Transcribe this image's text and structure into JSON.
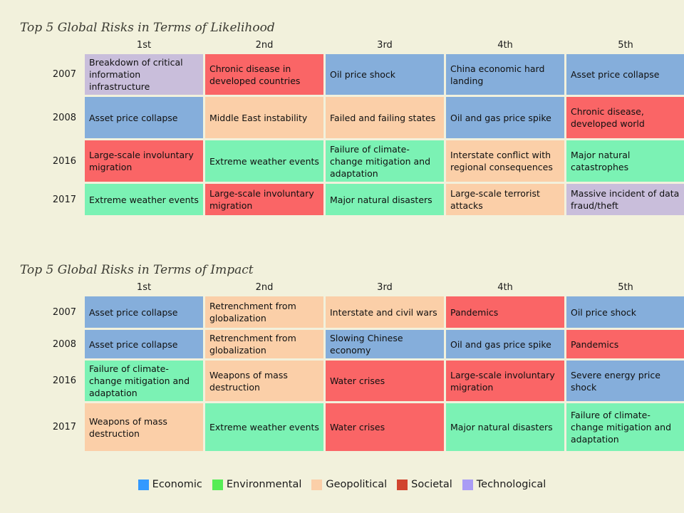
{
  "background_color": "#F2F1DC",
  "category_colors": {
    "economic": "#85AEDB",
    "environmental": "#7BF2B4",
    "geopolitical": "#FBCFA8",
    "societal": "#FA6566",
    "technological": "#C9BEDB"
  },
  "likelihood": {
    "title": "Top 5 Global Risks in Terms of Likelihood",
    "columns": [
      "1st",
      "2nd",
      "3rd",
      "4th",
      "5th"
    ],
    "rows": [
      {
        "year": "2007",
        "cells": [
          {
            "text": "Breakdown of critical information infrastructure",
            "category": "technological"
          },
          {
            "text": "Chronic disease in developed countries",
            "category": "societal"
          },
          {
            "text": "Oil price shock",
            "category": "economic"
          },
          {
            "text": "China economic hard landing",
            "category": "economic"
          },
          {
            "text": "Asset price collapse",
            "category": "economic"
          }
        ]
      },
      {
        "year": "2008",
        "cells": [
          {
            "text": "Asset price collapse",
            "category": "economic"
          },
          {
            "text": "Middle East instability",
            "category": "geopolitical"
          },
          {
            "text": "Failed and failing states",
            "category": "geopolitical"
          },
          {
            "text": "Oil and gas price spike",
            "category": "economic"
          },
          {
            "text": "Chronic disease, developed world",
            "category": "societal"
          }
        ]
      },
      {
        "year": "2016",
        "cells": [
          {
            "text": "Large-scale involuntary migration",
            "category": "societal"
          },
          {
            "text": "Extreme weather events",
            "category": "environmental"
          },
          {
            "text": "Failure of climate-change mitigation and adaptation",
            "category": "environmental"
          },
          {
            "text": "Interstate conflict with regional consequences",
            "category": "geopolitical"
          },
          {
            "text": "Major natural catastrophes",
            "category": "environmental"
          }
        ]
      },
      {
        "year": "2017",
        "cells": [
          {
            "text": "Extreme weather events",
            "category": "environmental"
          },
          {
            "text": "Large-scale involuntary migration",
            "category": "societal"
          },
          {
            "text": "Major natural disasters",
            "category": "environmental"
          },
          {
            "text": "Large-scale terrorist attacks",
            "category": "geopolitical"
          },
          {
            "text": "Massive incident of data fraud/theft",
            "category": "technological"
          }
        ]
      }
    ]
  },
  "impact": {
    "title": "Top 5 Global Risks in Terms of Impact",
    "columns": [
      "1st",
      "2nd",
      "3rd",
      "4th",
      "5th"
    ],
    "rows": [
      {
        "year": "2007",
        "cells": [
          {
            "text": "Asset price collapse",
            "category": "economic"
          },
          {
            "text": "Retrenchment from globalization",
            "category": "geopolitical"
          },
          {
            "text": "Interstate and civil wars",
            "category": "geopolitical"
          },
          {
            "text": "Pandemics",
            "category": "societal"
          },
          {
            "text": "Oil price shock",
            "category": "economic"
          }
        ]
      },
      {
        "year": "2008",
        "cells": [
          {
            "text": "Asset price collapse",
            "category": "economic"
          },
          {
            "text": "Retrenchment from globalization",
            "category": "geopolitical"
          },
          {
            "text": "Slowing Chinese economy",
            "category": "economic"
          },
          {
            "text": "Oil and gas price spike",
            "category": "economic"
          },
          {
            "text": "Pandemics",
            "category": "societal"
          }
        ]
      },
      {
        "year": "2016",
        "cells": [
          {
            "text": "Failure of climate-change mitigation and adaptation",
            "category": "environmental"
          },
          {
            "text": "Weapons of mass destruction",
            "category": "geopolitical"
          },
          {
            "text": "Water crises",
            "category": "societal"
          },
          {
            "text": "Large-scale involuntary migration",
            "category": "societal"
          },
          {
            "text": "Severe energy price shock",
            "category": "economic"
          }
        ]
      },
      {
        "year": "2017",
        "cells": [
          {
            "text": "Weapons of mass destruction",
            "category": "geopolitical"
          },
          {
            "text": "Extreme weather events",
            "category": "environmental"
          },
          {
            "text": "Water crises",
            "category": "societal"
          },
          {
            "text": "Major natural disasters",
            "category": "environmental"
          },
          {
            "text": "Failure of climate-change mitigation and adaptation",
            "category": "environmental"
          }
        ]
      }
    ]
  },
  "legend": {
    "items": [
      {
        "label": "Economic",
        "color": "#3399FF"
      },
      {
        "label": "Environmental",
        "color": "#55ED55"
      },
      {
        "label": "Geopolitical",
        "color": "#FBCFA8"
      },
      {
        "label": "Societal",
        "color": "#D1452F"
      },
      {
        "label": "Technological",
        "color": "#A99CF5"
      }
    ]
  }
}
